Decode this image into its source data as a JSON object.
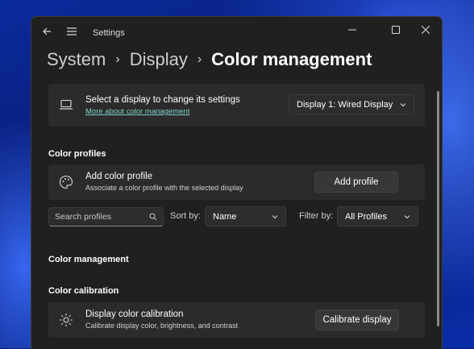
{
  "window": {
    "app_title": "Settings"
  },
  "titlebar": {
    "back_icon": "back-arrow-icon",
    "menu_icon": "hamburger-menu-icon"
  },
  "breadcrumb": {
    "items": [
      "System",
      "Display"
    ],
    "current": "Color management"
  },
  "display_select": {
    "title": "Select a display to change its settings",
    "link": "More about color management",
    "selected": "Display 1: Wired Display",
    "icon": "laptop-icon"
  },
  "color_profiles": {
    "heading": "Color profiles",
    "add_title": "Add color profile",
    "add_subtitle": "Associate a color profile with the selected display",
    "add_button": "Add profile",
    "icon": "palette-icon"
  },
  "filters": {
    "search_placeholder": "Search profiles",
    "sort_label": "Sort by:",
    "sort_value": "Name",
    "filter_label": "Filter by:",
    "filter_value": "All Profiles"
  },
  "color_management": {
    "heading": "Color management"
  },
  "calibration": {
    "heading": "Color calibration",
    "title": "Display color calibration",
    "subtitle": "Calibrate display color, brightness, and contrast",
    "button": "Calibrate display",
    "icon": "brightness-icon"
  },
  "colors": {
    "window_bg": "#202020",
    "card_bg": "#2b2b2b",
    "link": "#7dd3c8"
  }
}
